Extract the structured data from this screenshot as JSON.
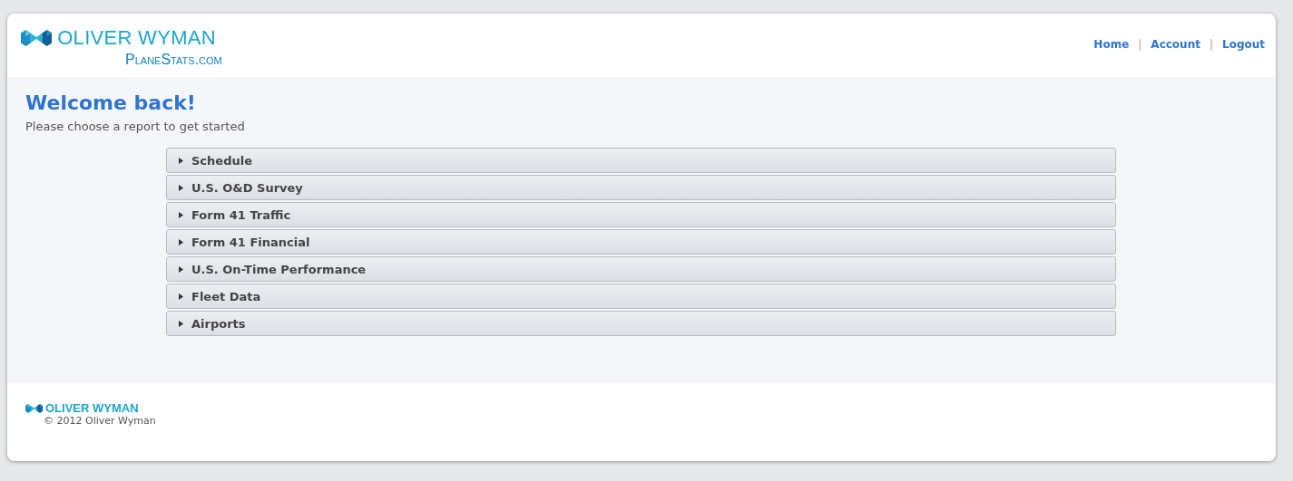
{
  "header": {
    "brand": "OLIVER WYMAN",
    "site": "PlaneStats.com",
    "nav": [
      "Home",
      "Account",
      "Logout"
    ],
    "separators": [
      "|",
      "|"
    ]
  },
  "welcome": {
    "title": "Welcome back!",
    "subtitle": "Please choose a report to get started"
  },
  "reports": [
    {
      "label": "Schedule",
      "expanded": false
    },
    {
      "label": "U.S. O&D Survey",
      "expanded": false
    },
    {
      "label": "Form 41 Traffic",
      "expanded": false
    },
    {
      "label": "Form 41 Financial",
      "expanded": false
    },
    {
      "label": "U.S. On-Time Performance",
      "expanded": false
    },
    {
      "label": "Fleet Data",
      "expanded": false
    },
    {
      "label": "Airports",
      "expanded": false
    }
  ],
  "footer": {
    "brand": "OLIVER WYMAN",
    "copyright": "© 2012 Oliver Wyman"
  }
}
